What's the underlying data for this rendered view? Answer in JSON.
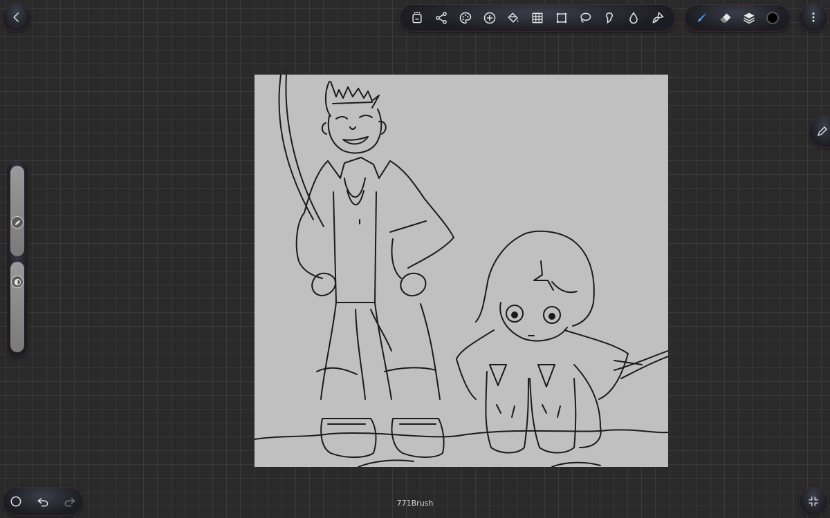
{
  "app": {
    "brush_name": "771Brush"
  },
  "top_bar": {
    "back_icon": "chevron-left-icon",
    "menu_icon": "more-vertical-icon"
  },
  "toolbar": {
    "tools": [
      {
        "name": "gallery-tool",
        "icon": "gallery-save-icon"
      },
      {
        "name": "share-tool",
        "icon": "share-icon"
      },
      {
        "name": "palette-tool",
        "icon": "palette-icon"
      },
      {
        "name": "add-tool",
        "icon": "plus-circle-icon"
      },
      {
        "name": "fill-tool",
        "icon": "paint-bucket-icon"
      },
      {
        "name": "grid-tool",
        "icon": "grid-icon"
      },
      {
        "name": "transform-tool",
        "icon": "crop-icon"
      },
      {
        "name": "lasso-tool",
        "icon": "lasso-icon"
      },
      {
        "name": "smudge-tool",
        "icon": "smudge-icon"
      },
      {
        "name": "blur-tool",
        "icon": "drop-icon"
      },
      {
        "name": "brush-select-tool",
        "icon": "brush-icon"
      }
    ]
  },
  "brush_bar": {
    "brush_icon": "pen-icon",
    "eraser_icon": "eraser-icon",
    "layers_icon": "layers-icon",
    "current_color": "#000000",
    "accent_color": "#4aa3ff"
  },
  "sliders": {
    "size_icon": "pencil-icon",
    "opacity_icon": "opacity-icon",
    "size_level": 0.32,
    "opacity_level": 0.12
  },
  "bottom": {
    "quick_icon": "circle-icon",
    "undo_icon": "undo-icon",
    "redo_icon": "redo-icon",
    "fullscreen_icon": "collapse-icon"
  },
  "colors": {
    "canvas_bg": "#c0c0c0",
    "workspace_bg": "#2a2a2a"
  }
}
